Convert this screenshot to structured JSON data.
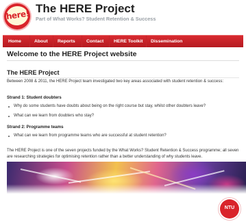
{
  "header": {
    "logo_text": "here!",
    "title": "The HERE Project",
    "subtitle": "Part of What Works? Student Retention & Success"
  },
  "nav": {
    "items": [
      "Home",
      "About",
      "Reports",
      "Contact",
      "HERE Toolkit",
      "Dissemination"
    ]
  },
  "main": {
    "page_heading": "Welcome to the HERE Project website",
    "section_heading": "The HERE Project",
    "intro": "Between 2008 & 2011, the HERE Project team investigated two key areas associated with student retention & success:",
    "strand1": {
      "heading": "Strand 1: Student doubters",
      "bullets": [
        "Why do some students have doubts about being on the right course but stay, whilst other doubters leave?",
        "What can we learn from doubters who stay?"
      ]
    },
    "strand2": {
      "heading": "Strand 2: Programme teams",
      "bullets": [
        "What can we learn from programme teams who are successful at student retention?"
      ]
    },
    "closing": "The HERE Project is one of the seven projects funded by the What Works? Student Retention & Success programme; all seven are researching strategies for optimising retention rather than a better understanding of why students leave."
  },
  "footer": {
    "badge_text": "NTU"
  },
  "colors": {
    "brand_red": "#d9232a",
    "nav_dark": "#b51a20",
    "text": "#333333"
  }
}
